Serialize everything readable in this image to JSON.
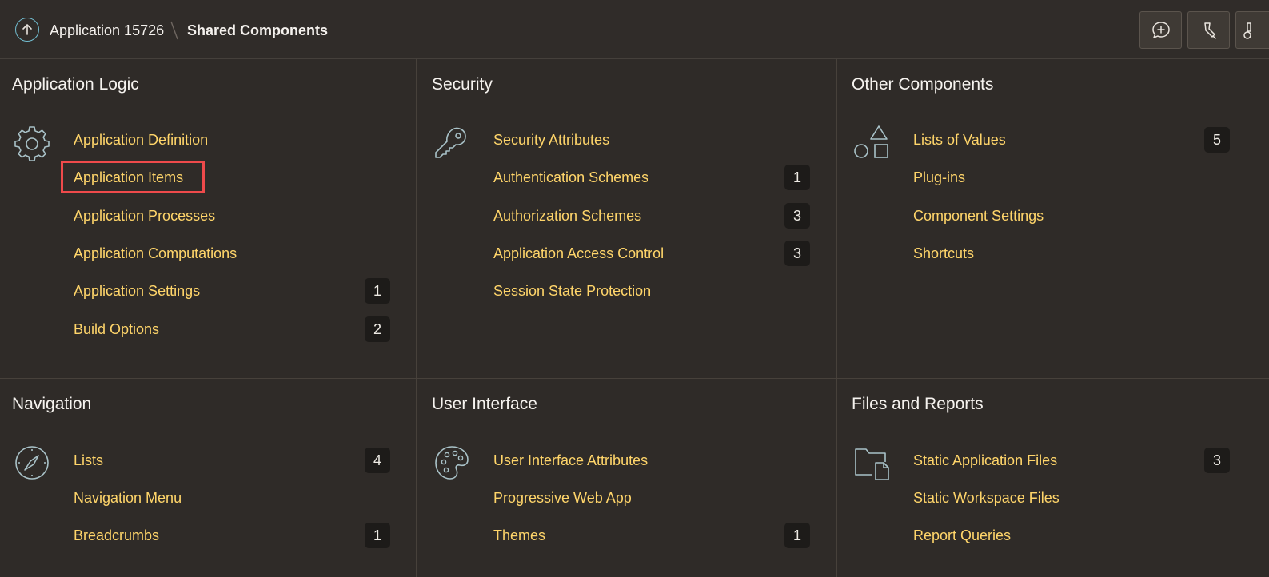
{
  "breadcrumb": {
    "app": "Application 15726",
    "current": "Shared Components"
  },
  "toolbar": {
    "buttons": [
      {
        "icon": "comment-plus-icon"
      },
      {
        "icon": "highlighter-icon"
      },
      {
        "icon": "brush-icon"
      }
    ]
  },
  "panels": [
    {
      "title": "Application Logic",
      "icon": "gear-icon",
      "items": [
        {
          "label": "Application Definition",
          "count": null
        },
        {
          "label": "Application Items",
          "count": null
        },
        {
          "label": "Application Processes",
          "count": null
        },
        {
          "label": "Application Computations",
          "count": null
        },
        {
          "label": "Application Settings",
          "count": "1"
        },
        {
          "label": "Build Options",
          "count": "2"
        }
      ]
    },
    {
      "title": "Security",
      "icon": "key-icon",
      "items": [
        {
          "label": "Security Attributes",
          "count": null
        },
        {
          "label": "Authentication Schemes",
          "count": "1"
        },
        {
          "label": "Authorization Schemes",
          "count": "3"
        },
        {
          "label": "Application Access Control",
          "count": "3"
        },
        {
          "label": "Session State Protection",
          "count": null
        }
      ]
    },
    {
      "title": "Other Components",
      "icon": "shapes-icon",
      "items": [
        {
          "label": "Lists of Values",
          "count": "5"
        },
        {
          "label": "Plug-ins",
          "count": null
        },
        {
          "label": "Component Settings",
          "count": null
        },
        {
          "label": "Shortcuts",
          "count": null
        }
      ]
    },
    {
      "title": "Navigation",
      "icon": "compass-icon",
      "items": [
        {
          "label": "Lists",
          "count": "4"
        },
        {
          "label": "Navigation Menu",
          "count": null
        },
        {
          "label": "Breadcrumbs",
          "count": "1"
        }
      ]
    },
    {
      "title": "User Interface",
      "icon": "palette-icon",
      "items": [
        {
          "label": "User Interface Attributes",
          "count": null
        },
        {
          "label": "Progressive Web App",
          "count": null
        },
        {
          "label": "Themes",
          "count": "1"
        }
      ]
    },
    {
      "title": "Files and Reports",
      "icon": "folder-file-icon",
      "items": [
        {
          "label": "Static Application Files",
          "count": "3"
        },
        {
          "label": "Static Workspace Files",
          "count": null
        },
        {
          "label": "Report Queries",
          "count": null
        }
      ]
    }
  ],
  "highlight": {
    "target": "Application Items",
    "color": "#ef4a4b"
  },
  "colors": {
    "background": "#2f2b28",
    "link": "#ffd56a",
    "icon": "#a9c2c8",
    "accent": "#72bed1"
  }
}
